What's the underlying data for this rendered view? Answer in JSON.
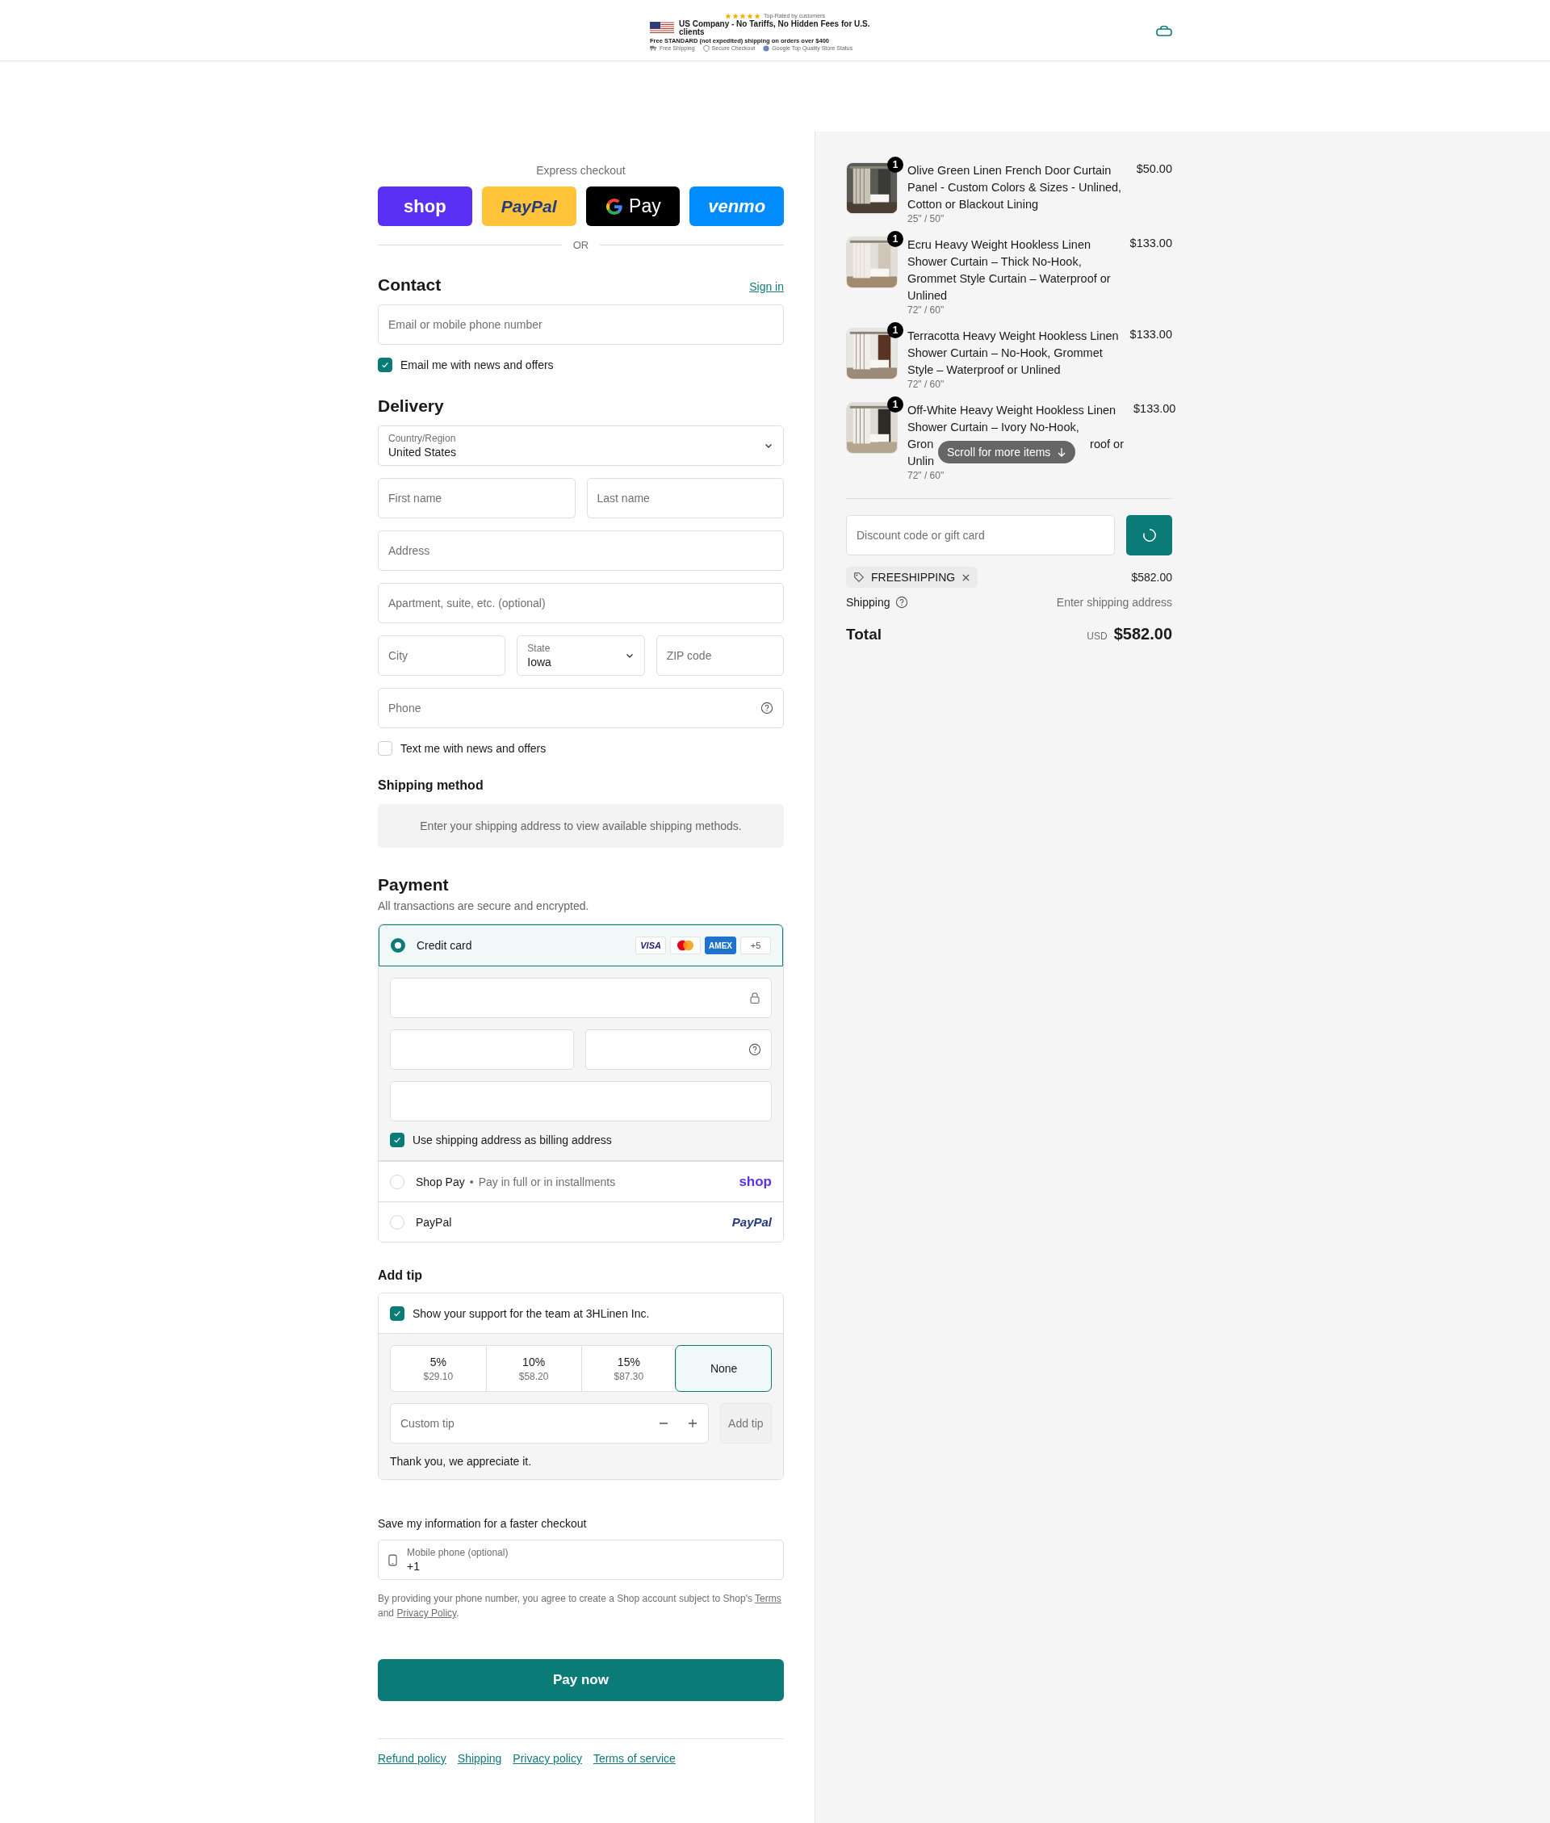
{
  "header": {
    "stars": 5,
    "rating_text": "Top-Rated by customers",
    "headline": "US Company - No Tariffs, No Hidden Fees for U.S. clients",
    "shipping_note": "Free STANDARD (not expedited) shipping on orders over $400",
    "badges": [
      {
        "kind": "truck",
        "label": "Free Shipping"
      },
      {
        "kind": "shield",
        "label": "Secure Checkout"
      },
      {
        "kind": "seal",
        "label": "Google Top Quality Store Status"
      }
    ]
  },
  "express_checkout": {
    "title": "Express checkout",
    "buttons": [
      {
        "kind": "shop",
        "label": "shop"
      },
      {
        "kind": "paypal",
        "label": "PayPal"
      },
      {
        "kind": "gpay",
        "label": "Pay"
      },
      {
        "kind": "venmo",
        "label": "venmo"
      }
    ],
    "divider": "OR"
  },
  "contact": {
    "title": "Contact",
    "sign_in": "Sign in",
    "email_placeholder": "Email or mobile phone number",
    "news": {
      "label": "Email me with news and offers",
      "checked": true
    }
  },
  "delivery": {
    "title": "Delivery",
    "country": {
      "label": "Country/Region",
      "value": "United States"
    },
    "first_name_placeholder": "First name",
    "last_name_placeholder": "Last name",
    "address_placeholder": "Address",
    "apartment_placeholder": "Apartment, suite, etc. (optional)",
    "city_placeholder": "City",
    "state": {
      "label": "State",
      "value": "Iowa"
    },
    "zip_placeholder": "ZIP code",
    "phone_placeholder": "Phone",
    "text_news": {
      "label": "Text me with news and offers",
      "checked": false
    }
  },
  "shipping_method": {
    "title": "Shipping method",
    "message": "Enter your shipping address to view available shipping methods."
  },
  "payment": {
    "title": "Payment",
    "subtitle": "All transactions are secure and encrypted.",
    "methods": [
      {
        "kind": "card",
        "label": "Credit card",
        "selected": true,
        "brands": [
          {
            "kind": "visa",
            "label": "VISA"
          },
          {
            "kind": "mastercard"
          },
          {
            "kind": "amex",
            "label": "AMEX"
          },
          {
            "kind": "more",
            "label": "+5"
          }
        ]
      },
      {
        "kind": "shop_pay",
        "label": "Shop Pay",
        "separator": "•",
        "detail": "Pay in full or in installments",
        "logo": "shop",
        "selected": false
      },
      {
        "kind": "paypal",
        "label": "PayPal",
        "logo": "PayPal",
        "selected": false
      }
    ],
    "billing": {
      "label": "Use shipping address as billing address",
      "checked": true
    }
  },
  "tip": {
    "title": "Add tip",
    "support": {
      "label": "Show your support for the team at 3HLinen Inc.",
      "checked": true
    },
    "options": [
      {
        "label": "5%",
        "amount": "$29.10",
        "selected": false
      },
      {
        "label": "10%",
        "amount": "$58.20",
        "selected": false
      },
      {
        "label": "15%",
        "amount": "$87.30",
        "selected": false
      },
      {
        "label": "None",
        "selected": true
      }
    ],
    "custom_placeholder": "Custom tip",
    "add_button": {
      "label": "Add tip",
      "disabled": true
    },
    "thanks": "Thank you, we appreciate it."
  },
  "save_info": {
    "title": "Save my information for a faster checkout",
    "phone_label": "Mobile phone (optional)",
    "phone_value": "+1",
    "consent": "By providing your phone number, you agree to create a Shop account subject to Shop's",
    "terms_link": "Terms",
    "joiner": "and",
    "privacy_link": "Privacy Policy",
    "end": "."
  },
  "pay_button": "Pay now",
  "footer_links": [
    "Refund policy",
    "Shipping",
    "Privacy policy",
    "Terms of service"
  ],
  "summary": {
    "items": [
      {
        "title": "Olive Green Linen French Door Curtain Panel - Custom Colors & Sizes - Unlined, Cotton or Blackout Lining",
        "variant": "25\" / 50\"",
        "price": "$50.00",
        "quantity": "1"
      },
      {
        "title": "Ecru Heavy Weight Hookless Linen Shower Curtain – Thick No-Hook, Grommet Style Curtain – Waterproof or Unlined",
        "variant": "72\" / 60\"",
        "price": "$133.00",
        "quantity": "1"
      },
      {
        "title": "Terracotta Heavy Weight Hookless Linen Shower Curtain – No-Hook, Grommet Style – Waterproof or Unlined",
        "variant": "72\" / 60\"",
        "price": "$133.00",
        "quantity": "1"
      },
      {
        "title": "Off-White Heavy Weight Hookless Linen Shower Curtain – Ivory No-Hook,",
        "covered_fragments": [
          "Gron",
          "roof or",
          "Unlin"
        ],
        "variant": "72\" / 60\"",
        "price": "$133.00",
        "quantity": "1"
      }
    ],
    "scroll_hint": "Scroll for more items",
    "discount_placeholder": "Discount code or gift card",
    "discount_code": "FREESHIPPING",
    "subtotal": "$582.00",
    "shipping_label": "Shipping",
    "shipping_value": "Enter shipping address",
    "total_label": "Total",
    "currency": "USD",
    "total": "$582.00"
  }
}
